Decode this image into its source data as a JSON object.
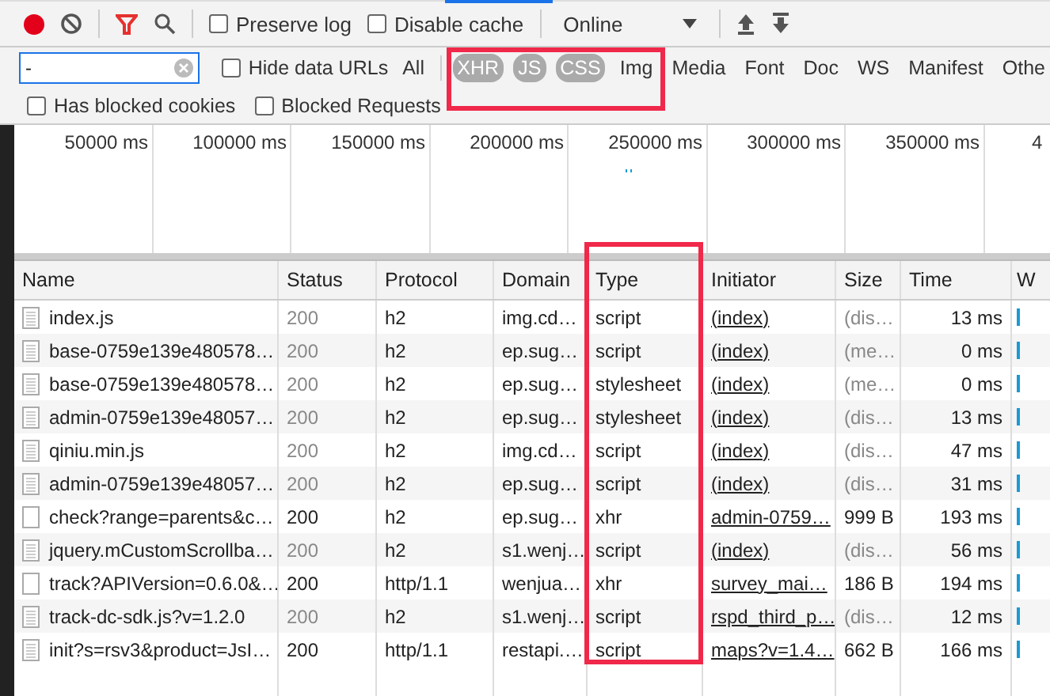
{
  "toolbar": {
    "recording": true,
    "filter_active": true,
    "preserve_log": {
      "label": "Preserve log",
      "checked": false
    },
    "disable_cache": {
      "label": "Disable cache",
      "checked": false
    },
    "throttling": "Online"
  },
  "filter_bar": {
    "search_value": "-",
    "hide_data_urls": {
      "label": "Hide data URLs",
      "checked": false
    },
    "types": [
      {
        "label": "All",
        "selected": false
      },
      {
        "label": "XHR",
        "selected": true
      },
      {
        "label": "JS",
        "selected": true
      },
      {
        "label": "CSS",
        "selected": true
      },
      {
        "label": "Img",
        "selected": false
      },
      {
        "label": "Media",
        "selected": false
      },
      {
        "label": "Font",
        "selected": false
      },
      {
        "label": "Doc",
        "selected": false
      },
      {
        "label": "WS",
        "selected": false
      },
      {
        "label": "Manifest",
        "selected": false
      },
      {
        "label": "Othe",
        "selected": false
      }
    ]
  },
  "options": [
    {
      "label": "Has blocked cookies",
      "checked": false
    },
    {
      "label": "Blocked Requests",
      "checked": false
    }
  ],
  "timeline": {
    "ticks": [
      "50000 ms",
      "100000 ms",
      "150000 ms",
      "200000 ms",
      "250000 ms",
      "300000 ms",
      "350000 ms",
      "4"
    ]
  },
  "table": {
    "columns": [
      "Name",
      "Status",
      "Protocol",
      "Domain",
      "Type",
      "Initiator",
      "Size",
      "Time",
      "W"
    ],
    "rows": [
      {
        "kind": "document",
        "cached": true,
        "name": "index.js",
        "status": "200",
        "protocol": "h2",
        "domain": "img.cd…",
        "type": "script",
        "initiator": "(index)",
        "size": "(dis…",
        "time": "13 ms"
      },
      {
        "kind": "document",
        "cached": true,
        "name": "base-0759e139e480578…",
        "status": "200",
        "protocol": "h2",
        "domain": "ep.sug…",
        "type": "script",
        "initiator": "(index)",
        "size": "(me…",
        "time": "0 ms"
      },
      {
        "kind": "document",
        "cached": true,
        "name": "base-0759e139e480578…",
        "status": "200",
        "protocol": "h2",
        "domain": "ep.sug…",
        "type": "stylesheet",
        "initiator": "(index)",
        "size": "(me…",
        "time": "0 ms"
      },
      {
        "kind": "document",
        "cached": true,
        "name": "admin-0759e139e48057…",
        "status": "200",
        "protocol": "h2",
        "domain": "ep.sug…",
        "type": "stylesheet",
        "initiator": "(index)",
        "size": "(dis…",
        "time": "13 ms"
      },
      {
        "kind": "document",
        "cached": true,
        "name": "qiniu.min.js",
        "status": "200",
        "protocol": "h2",
        "domain": "img.cd…",
        "type": "script",
        "initiator": "(index)",
        "size": "(dis…",
        "time": "47 ms"
      },
      {
        "kind": "document",
        "cached": true,
        "name": "admin-0759e139e48057…",
        "status": "200",
        "protocol": "h2",
        "domain": "ep.sug…",
        "type": "script",
        "initiator": "(index)",
        "size": "(dis…",
        "time": "31 ms"
      },
      {
        "kind": "blank",
        "cached": false,
        "name": "check?range=parents&c…",
        "status": "200",
        "protocol": "h2",
        "domain": "ep.sug…",
        "type": "xhr",
        "initiator": "admin-0759…",
        "size": "999 B",
        "time": "193 ms"
      },
      {
        "kind": "document",
        "cached": true,
        "name": "jquery.mCustomScrollba…",
        "status": "200",
        "protocol": "h2",
        "domain": "s1.wenj…",
        "type": "script",
        "initiator": "(index)",
        "size": "(dis…",
        "time": "56 ms"
      },
      {
        "kind": "blank",
        "cached": false,
        "name": "track?APIVersion=0.6.0&…",
        "status": "200",
        "protocol": "http/1.1",
        "domain": "wenjua…",
        "type": "xhr",
        "initiator": "survey_mai…",
        "size": "186 B",
        "time": "194 ms"
      },
      {
        "kind": "document",
        "cached": true,
        "name": "track-dc-sdk.js?v=1.2.0",
        "status": "200",
        "protocol": "h2",
        "domain": "s1.wenj…",
        "type": "script",
        "initiator": "rspd_third_p…",
        "size": "(dis…",
        "time": "12 ms"
      },
      {
        "kind": "document",
        "cached": false,
        "name": "init?s=rsv3&product=JsI…",
        "status": "200",
        "protocol": "http/1.1",
        "domain": "restapi.…",
        "type": "script",
        "initiator": "maps?v=1.4…",
        "size": "662 B",
        "time": "166 ms"
      }
    ]
  }
}
